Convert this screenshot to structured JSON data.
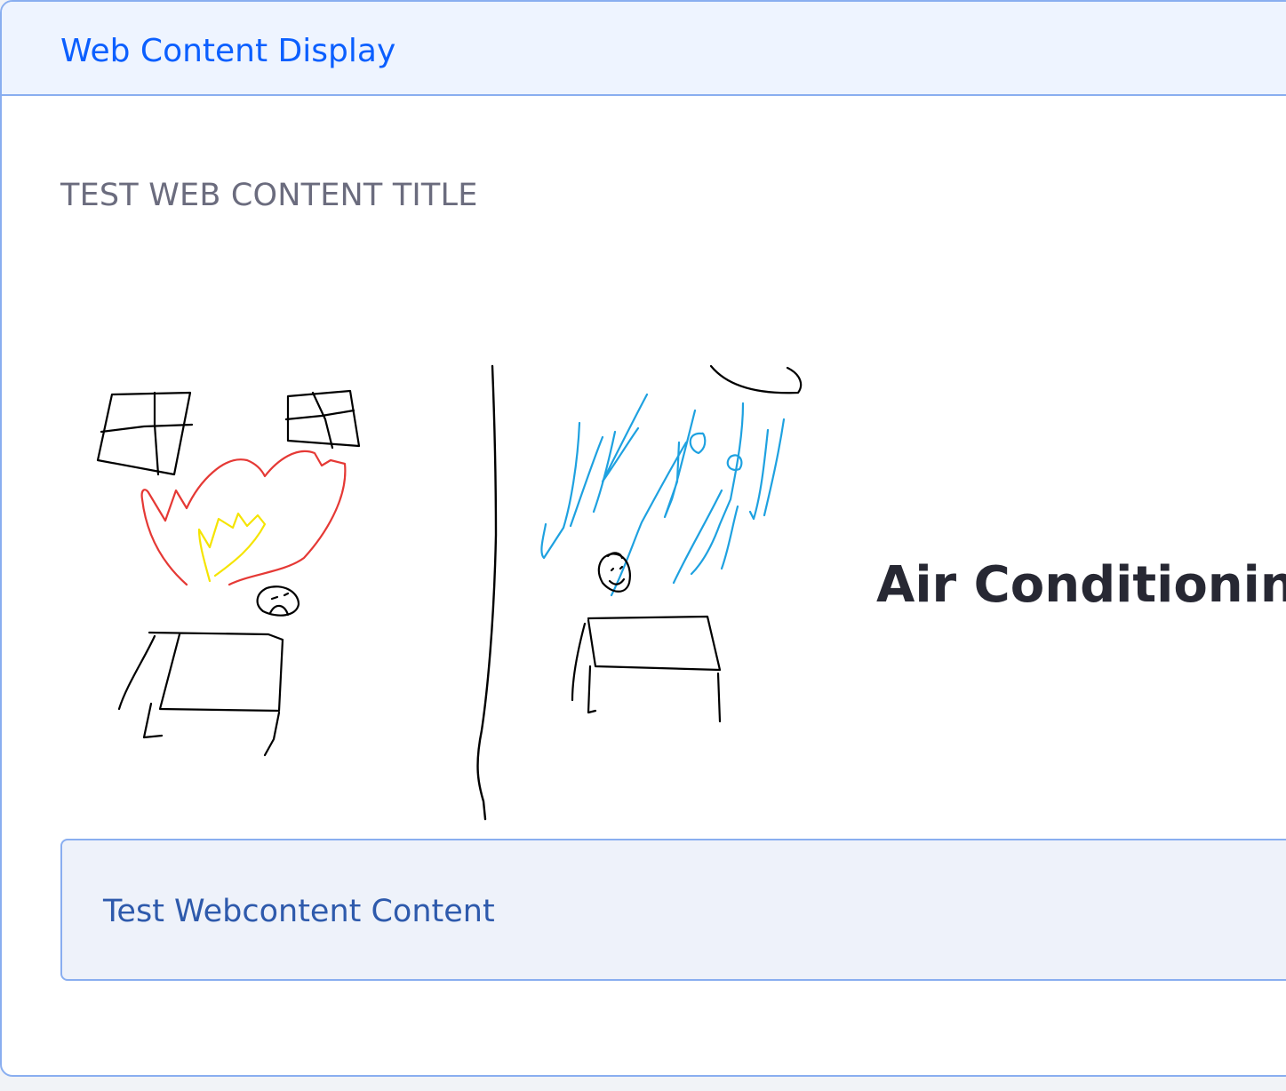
{
  "portlet": {
    "title": "Web Content Display"
  },
  "article": {
    "title": "TEST WEB CONTENT TITLE",
    "image_caption": "Air Conditioning",
    "body": "Test Webcontent Content"
  },
  "colors": {
    "accent": "#0b5fff",
    "border": "#89aef0",
    "header_bg": "#eef4ff",
    "alert_bg": "#eef2fa",
    "alert_text": "#2e5aac",
    "fire_red": "#e53935",
    "fire_yellow": "#f5e400",
    "ac_blue": "#1ea1e0"
  }
}
